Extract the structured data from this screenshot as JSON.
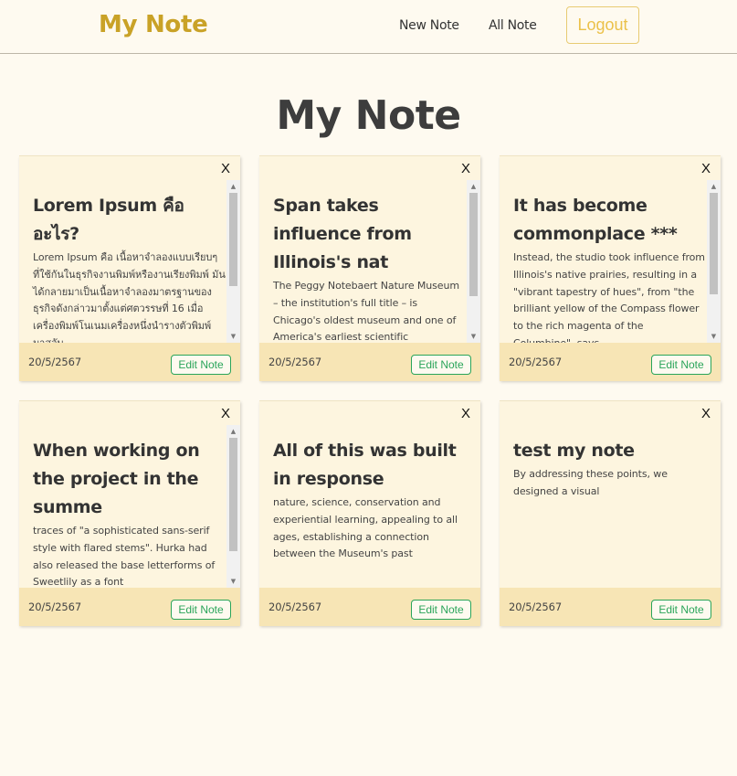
{
  "navbar": {
    "brand": "My Note",
    "new_note": "New Note",
    "all_note": "All Note",
    "logout": "Logout"
  },
  "page": {
    "title": "My Note"
  },
  "card_common": {
    "close": "X",
    "edit": "Edit Note"
  },
  "notes": [
    {
      "title": "Lorem Ipsum คือ อะไร?",
      "body": "Lorem Ipsum คือ เนื้อหาจำลองแบบเรียบๆ ที่ใช้กันในธุรกิจงานพิมพ์หรืองานเรียงพิมพ์ มันได้กลายมาเป็นเนื้อหาจำลองมาตรฐานของธุรกิจดังกล่าวมาตั้งแต่ศตวรรษที่ 16 เมื่อเครื่องพิมพ์โนเนมเครื่องหนึ่งนำรางตัวพิมพ์มาสลับ",
      "date": "20/5/2567",
      "scroll_position": 0.0
    },
    {
      "title": "Span takes influence from Illinois's nat",
      "body": "The Peggy Notebaert Nature Museum – the institution's full title – is Chicago's oldest museum and one of America's earliest scientific",
      "date": "20/5/2567",
      "scroll_position": 0.0
    },
    {
      "title": "It has become commonplace ***",
      "body": "Instead, the studio took influence from Illinois's native prairies, resulting in a \"vibrant tapestry of hues\", from \"the brilliant yellow of the Compass flower to the rich magenta of the Columbine\", says",
      "date": "20/5/2567",
      "scroll_position": 0.0
    },
    {
      "title": "When working on the project in the summe",
      "body": "traces of \"a sophisticated sans-serif style with flared stems\". Hurka had also released the base letterforms of Sweetlily as a font",
      "date": "20/5/2567",
      "scroll_position": 0.0
    },
    {
      "title": "All of this was built in response",
      "body": "nature, science, conservation and experiential learning, appealing to all ages, establishing a connection between the Museum's past",
      "date": "20/5/2567",
      "scroll_position": null
    },
    {
      "title": "test my note",
      "body": "By addressing these points, we designed a visual",
      "date": "20/5/2567",
      "scroll_position": null
    }
  ]
}
